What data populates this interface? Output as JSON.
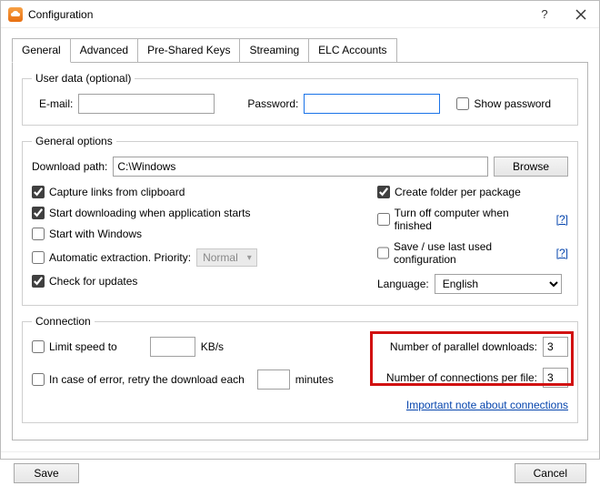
{
  "window": {
    "title": "Configuration",
    "help_btn": "?"
  },
  "tabs": {
    "general": "General",
    "advanced": "Advanced",
    "psk": "Pre-Shared Keys",
    "streaming": "Streaming",
    "elc": "ELC Accounts"
  },
  "user_data": {
    "legend": "User data (optional)",
    "email_label": "E-mail:",
    "email_value": "",
    "password_label": "Password:",
    "password_value": "",
    "show_password": "Show password"
  },
  "general_opts": {
    "legend": "General options",
    "download_path_label": "Download path:",
    "download_path_value": "C:\\Windows",
    "browse": "Browse",
    "capture_links": "Capture links from clipboard",
    "start_downloading": "Start downloading when application starts",
    "start_with_windows": "Start with Windows",
    "auto_extract": "Automatic extraction. Priority:",
    "priority_value": "Normal",
    "check_updates": "Check for updates",
    "create_folder": "Create folder per package",
    "turn_off": "Turn off computer when finished",
    "save_use_last": "Save / use last used configuration",
    "language_label": "Language:",
    "language_value": "English",
    "help_q": "[?]"
  },
  "connection": {
    "legend": "Connection",
    "limit_speed": "Limit speed to",
    "kbs": "KB/s",
    "retry": "In case of error, retry the download each",
    "minutes": "minutes",
    "parallel_label": "Number of parallel downloads:",
    "parallel_value": "3",
    "perfile_label": "Number of connections per file:",
    "perfile_value": "3",
    "note_link": "Important note about connections"
  },
  "footer": {
    "save": "Save",
    "cancel": "Cancel"
  }
}
